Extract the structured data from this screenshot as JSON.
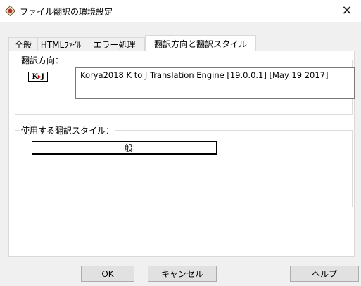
{
  "window": {
    "title": "ファイル翻訳の環境設定",
    "close_glyph": "✕"
  },
  "tabs": [
    {
      "label": "全般",
      "active": false
    },
    {
      "label": "HTMLﾌｧｲﾙ",
      "active": false
    },
    {
      "label": "エラー処理",
      "active": false
    },
    {
      "label": "翻訳方向と翻訳スタイル",
      "active": true
    }
  ],
  "direction_group": {
    "label": "翻訳方向：",
    "badge": "K▸J",
    "engines": [
      "Korya2018 K to J Translation Engine [19.0.0.1] [May 19 2017]"
    ]
  },
  "style_group": {
    "label": "使用する翻訳スタイル：",
    "selected_style": "一般"
  },
  "buttons": {
    "ok": "OK",
    "cancel": "キャンセル",
    "help": "ヘルプ"
  },
  "colors": {
    "badge_arrow": "#c00000",
    "app_icon": "#b03030"
  }
}
